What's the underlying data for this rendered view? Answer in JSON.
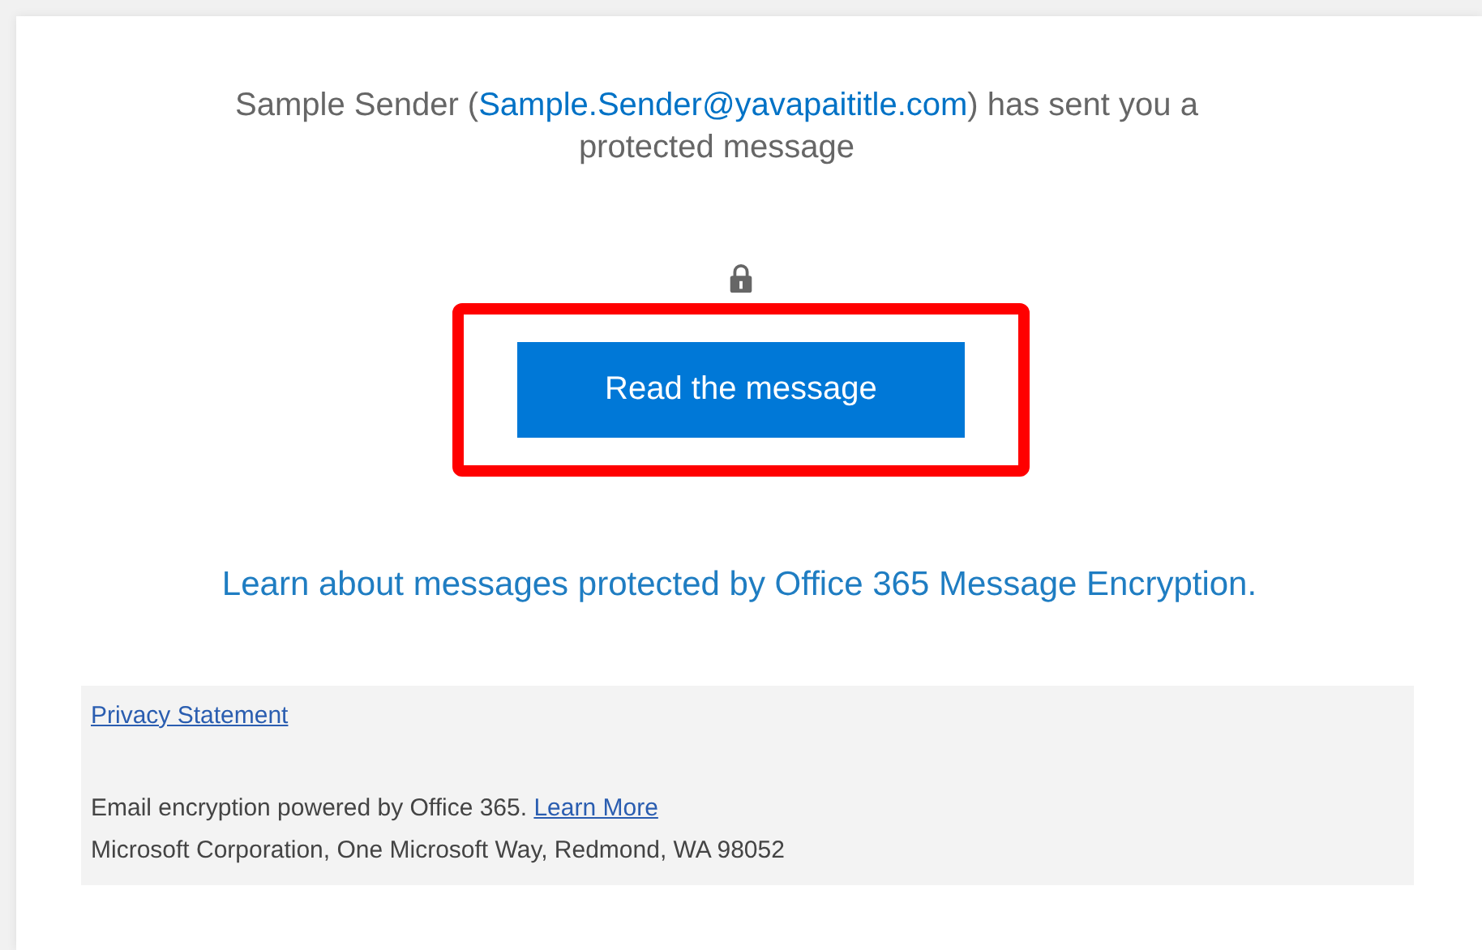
{
  "notice": {
    "before": "Sample Sender (",
    "link": "Sample.Sender@yavapaititle.com",
    "after": ") has sent you a protected message"
  },
  "read_button": {
    "label": "Read the message",
    "highlighted": true
  },
  "learn_link": "Learn about messages protected by Office 365 Message Encryption.",
  "footer": {
    "privacy_link": "Privacy Statement",
    "powered_text": "Email encryption powered by Office 365.",
    "learn_more_link": "Learn More",
    "address": "Microsoft Corporation, One Microsoft Way, Redmond, WA 98052"
  }
}
